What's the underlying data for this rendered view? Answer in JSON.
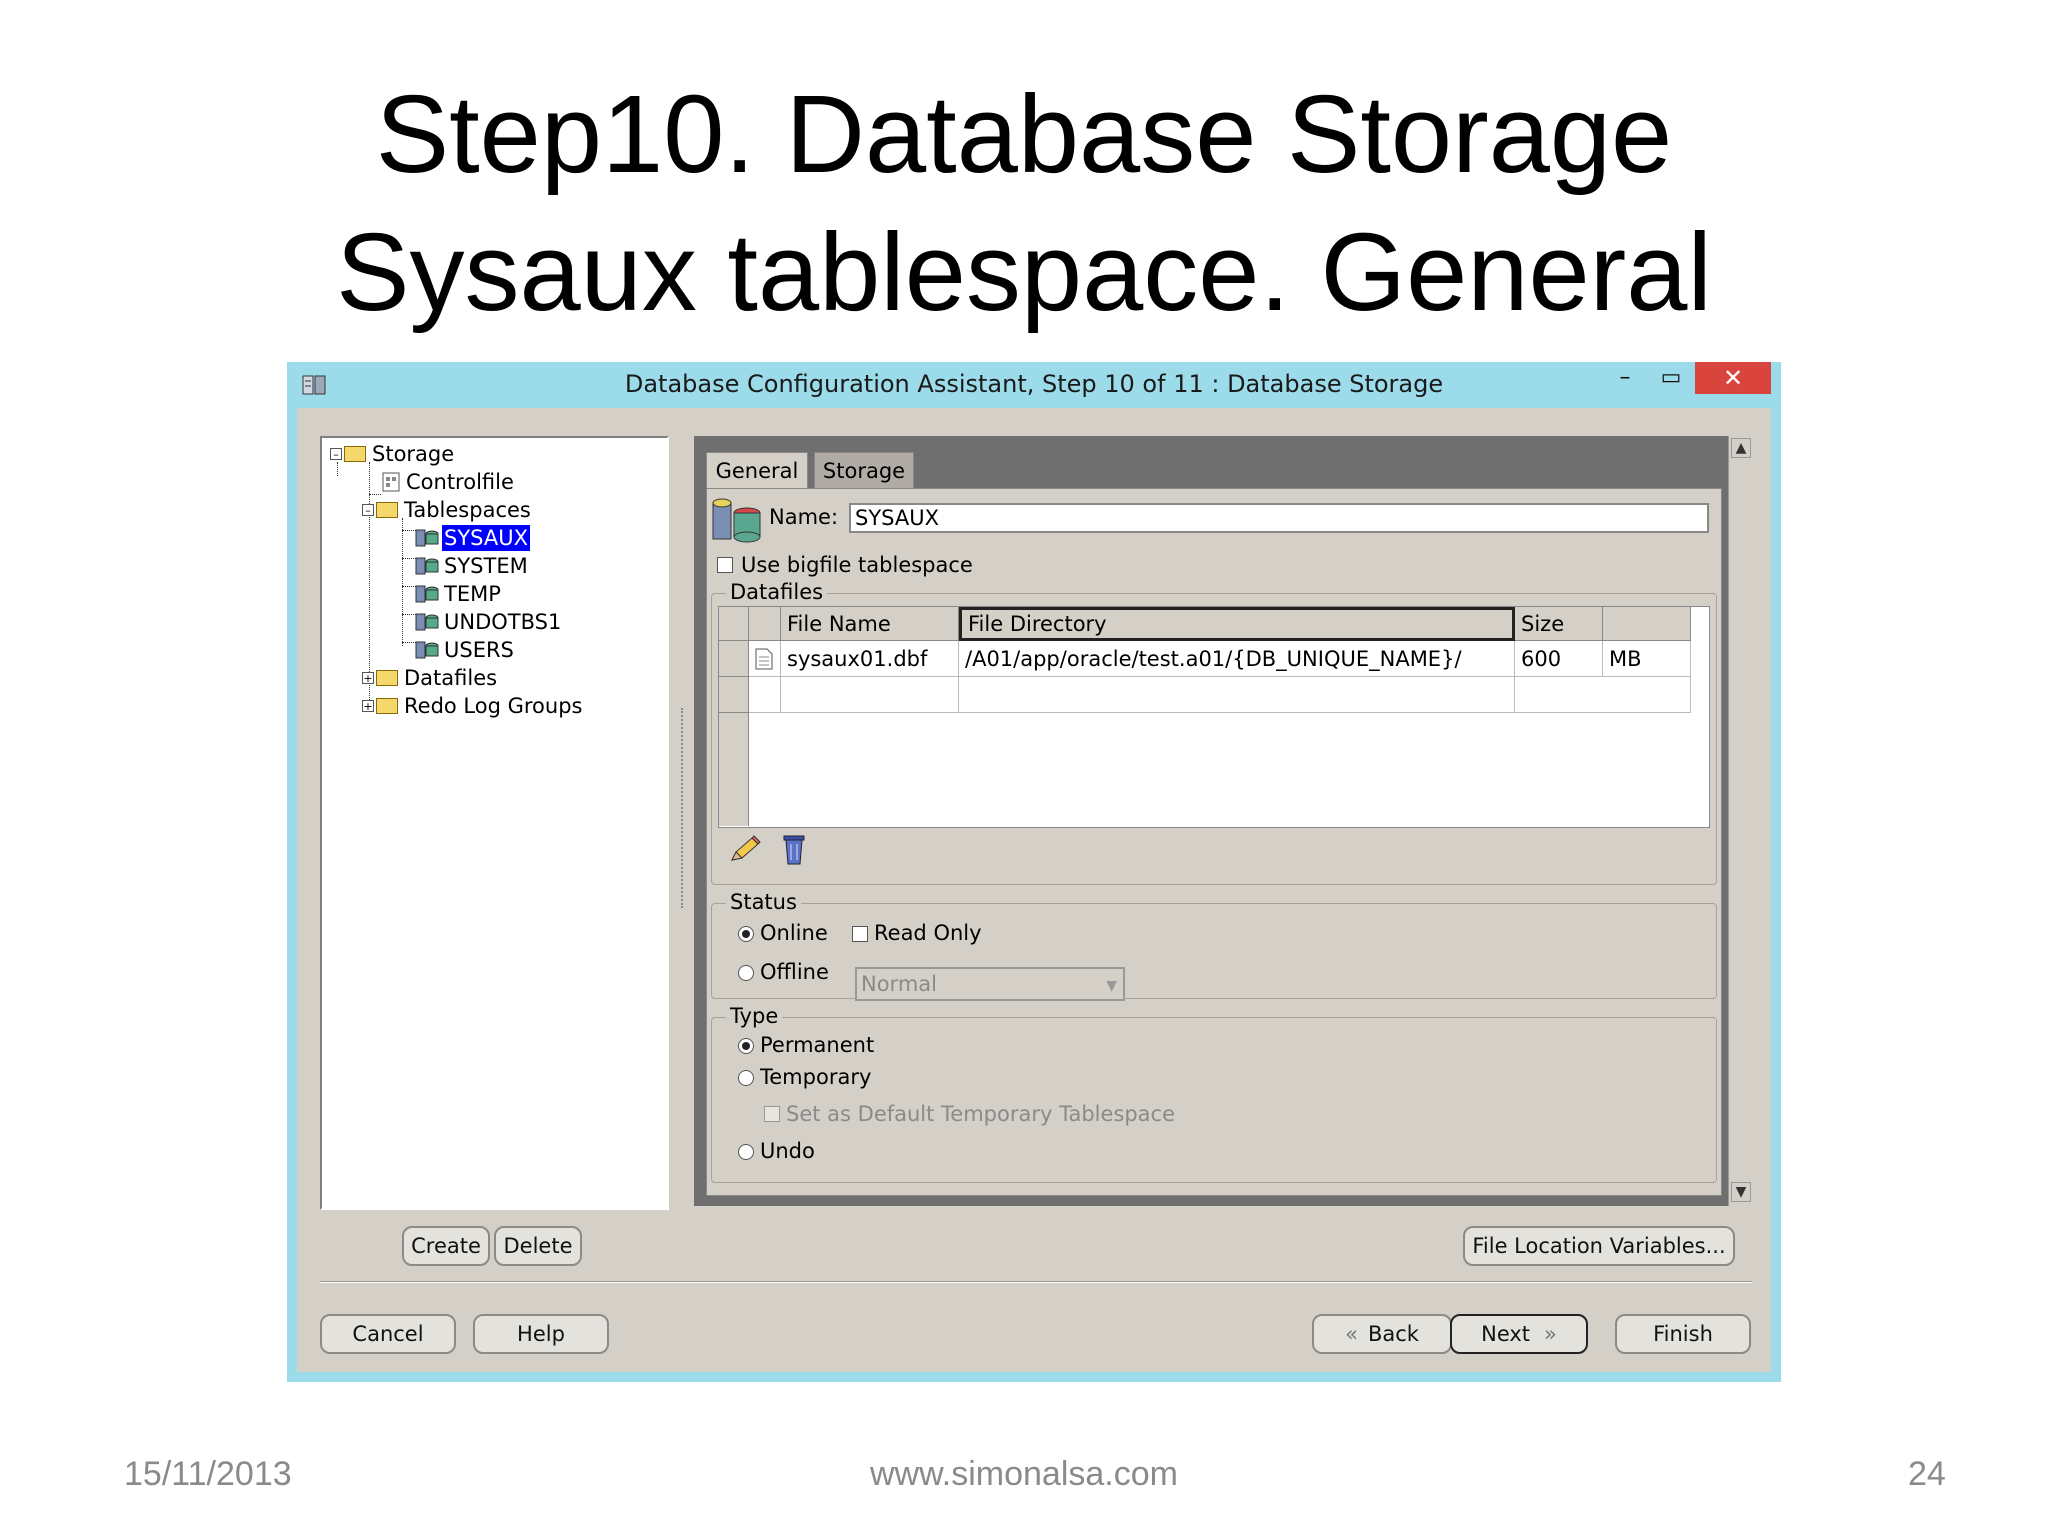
{
  "slide": {
    "title_line1": "Step10. Database Storage",
    "title_line2": "Sysaux tablespace. General",
    "date": "15/11/2013",
    "website": "www.simonalsa.com",
    "page_number": "24"
  },
  "window": {
    "title": "Database Configuration Assistant, Step 10 of 11 : Database Storage",
    "minimize": "–",
    "maximize": "▭",
    "close": "✕"
  },
  "tree": {
    "storage": "Storage",
    "controlfile": "Controlfile",
    "tablespaces": "Tablespaces",
    "items": [
      "SYSAUX",
      "SYSTEM",
      "TEMP",
      "UNDOTBS1",
      "USERS"
    ],
    "datafiles": "Datafiles",
    "redo": "Redo Log Groups",
    "create": "Create",
    "delete": "Delete"
  },
  "tabs": {
    "general": "General",
    "storage": "Storage"
  },
  "general": {
    "name_label": "Name:",
    "name_value": "SYSAUX",
    "bigfile_label": "Use bigfile tablespace",
    "datafiles_legend": "Datafiles",
    "columns": [
      "File Name",
      "File Directory",
      "Size",
      ""
    ],
    "row": {
      "file_name": "sysaux01.dbf",
      "directory": "/A01/app/oracle/test.a01/{DB_UNIQUE_NAME}/",
      "size": "600",
      "unit": "MB"
    },
    "status_legend": "Status",
    "online": "Online",
    "offline": "Offline",
    "read_only": "Read Only",
    "offline_mode": "Normal",
    "type_legend": "Type",
    "permanent": "Permanent",
    "temporary": "Temporary",
    "default_temp": "Set as Default Temporary Tablespace",
    "undo": "Undo"
  },
  "buttons": {
    "file_location": "File Location Variables...",
    "cancel": "Cancel",
    "help": "Help",
    "back": "Back",
    "next": "Next",
    "finish": "Finish"
  },
  "colors": {
    "window_frame": "#9cdbe9",
    "dialog_bg": "#d4d0c8",
    "selection": "#0000ff",
    "close": "#d9453c"
  }
}
